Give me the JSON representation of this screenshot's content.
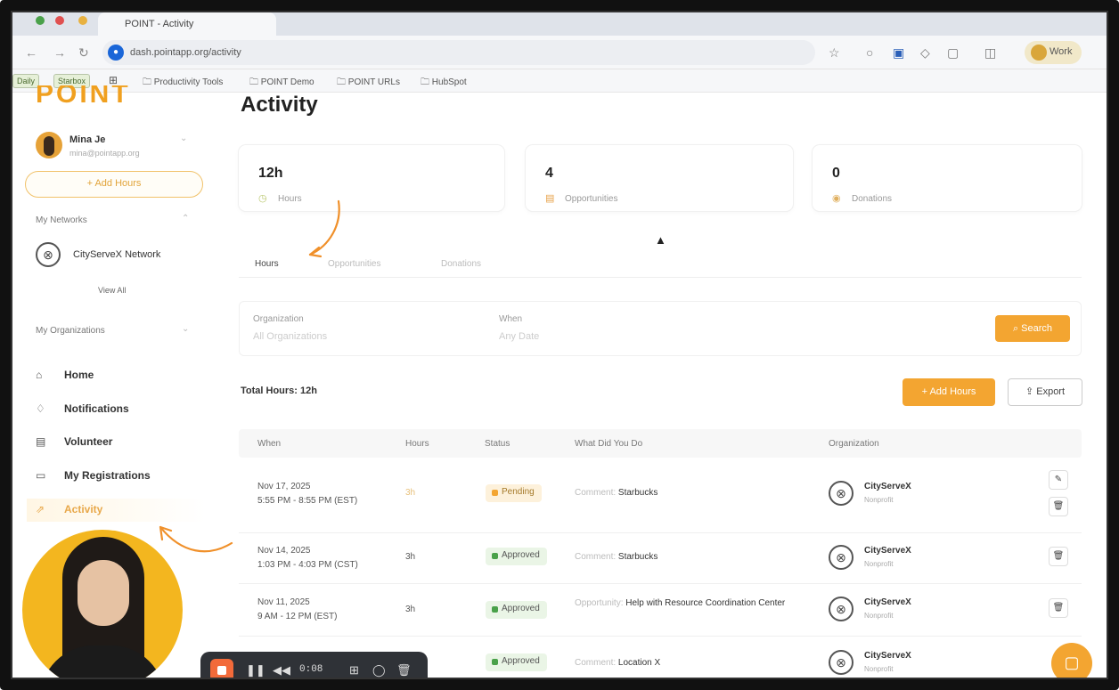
{
  "browser": {
    "tab_title": "POINT - Activity",
    "url": "dash.pointapp.org/activity",
    "profile_label": "Work",
    "bookmarks": [
      "Productivity Tools",
      "POINT Demo",
      "POINT URLs",
      "HubSpot"
    ]
  },
  "sidebar": {
    "logo": "POINT",
    "user_name": "Mina Je",
    "user_email": "mina@pointapp.org",
    "add_hours": "+ Add Hours",
    "networks_label": "My Networks",
    "network_name": "CityServeX Network",
    "view_all": "View All",
    "orgs_label": "My Organizations",
    "nav": [
      {
        "label": "Home",
        "icon": "home-icon"
      },
      {
        "label": "Notifications",
        "icon": "bell-icon"
      },
      {
        "label": "Volunteer",
        "icon": "calendar-icon"
      },
      {
        "label": "My Registrations",
        "icon": "registrations-icon"
      },
      {
        "label": "Activity",
        "icon": "activity-icon",
        "active": true
      }
    ]
  },
  "main": {
    "title": "Activity",
    "stats": [
      {
        "value": "12h",
        "label": "Hours",
        "icon": "clock-icon"
      },
      {
        "value": "4",
        "label": "Opportunities",
        "icon": "calendar-icon"
      },
      {
        "value": "0",
        "label": "Donations",
        "icon": "donation-icon"
      }
    ],
    "tabs": [
      "Hours",
      "Opportunities",
      "Donations"
    ],
    "filters": {
      "org_label": "Organization",
      "org_value": "All Organizations",
      "when_label": "When",
      "when_value": "Any Date",
      "search": "Search"
    },
    "total_hours": "Total Hours: 12h",
    "add_hours": "+ Add Hours",
    "export": "Export",
    "columns": [
      "When",
      "Hours",
      "Status",
      "What Did You Do",
      "Organization"
    ],
    "rows": [
      {
        "date": "Nov 17, 2025",
        "time": "5:55 PM - 8:55 PM (EST)",
        "hours": "3h",
        "status": "Pending",
        "lead": "Comment:",
        "what": "Starbucks",
        "org": "CityServeX",
        "org_type": "Nonprofit"
      },
      {
        "date": "Nov 14, 2025",
        "time": "1:03 PM - 4:03 PM (CST)",
        "hours": "3h",
        "status": "Approved",
        "lead": "Comment:",
        "what": "Starbucks",
        "org": "CityServeX",
        "org_type": "Nonprofit"
      },
      {
        "date": "Nov 11, 2025",
        "time": "9 AM - 12 PM (EST)",
        "hours": "3h",
        "status": "Approved",
        "lead": "Opportunity:",
        "what": "Help with Resource Coordination Center",
        "org": "CityServeX",
        "org_type": "Nonprofit"
      },
      {
        "date": "",
        "time": "",
        "hours": "",
        "status": "Approved",
        "lead": "Comment:",
        "what": "Location X",
        "org": "CityServeX",
        "org_type": "Nonprofit"
      }
    ]
  },
  "recorder": {
    "time": "0:08"
  },
  "colors": {
    "accent": "#f3a531",
    "approved": "#4aa14a"
  }
}
